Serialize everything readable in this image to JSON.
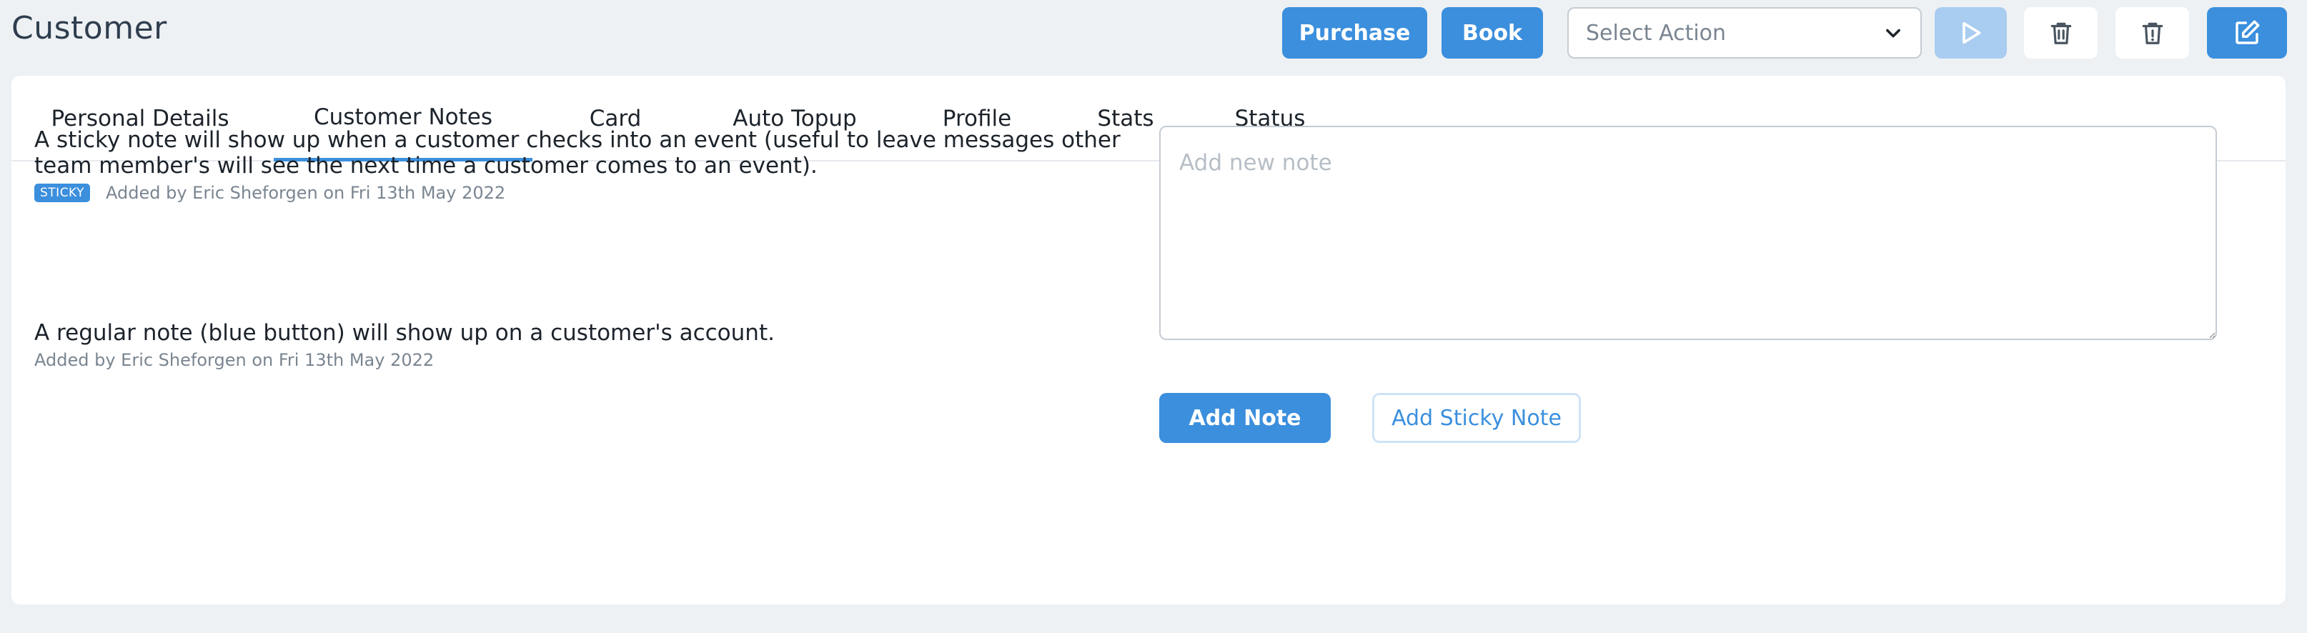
{
  "header": {
    "title": "Customer",
    "purchase_label": "Purchase",
    "book_label": "Book",
    "select_action": {
      "selected": "Select Action"
    },
    "icons": [
      "play-icon",
      "trash-icon",
      "trash-alert-icon",
      "edit-icon"
    ]
  },
  "tabs": [
    {
      "label": "Personal Details"
    },
    {
      "label": "Customer Notes",
      "active": true
    },
    {
      "label": "Card"
    },
    {
      "label": "Auto Topup"
    },
    {
      "label": "Profile"
    },
    {
      "label": "Stats"
    },
    {
      "label": "Status"
    }
  ],
  "notes": [
    {
      "text": "A sticky note will show up when a customer checks into an event (useful to leave messages other team member's will see the next time a customer comes to an event).",
      "badge": "STICKY",
      "meta": "Added by Eric Sheforgen on Fri 13th May 2022"
    },
    {
      "text": "A regular note (blue button) will show up on a customer's account.",
      "meta": "Added by Eric Sheforgen on Fri 13th May 2022"
    }
  ],
  "new_note": {
    "value": "",
    "placeholder": "Add new note",
    "add_note_label": "Add Note",
    "add_sticky_label": "Add Sticky Note"
  },
  "colors": {
    "accent": "#3b8fdd",
    "accent_disabled": "#a9cdf0",
    "background": "#eef1f4",
    "muted_text": "#7a8591"
  }
}
